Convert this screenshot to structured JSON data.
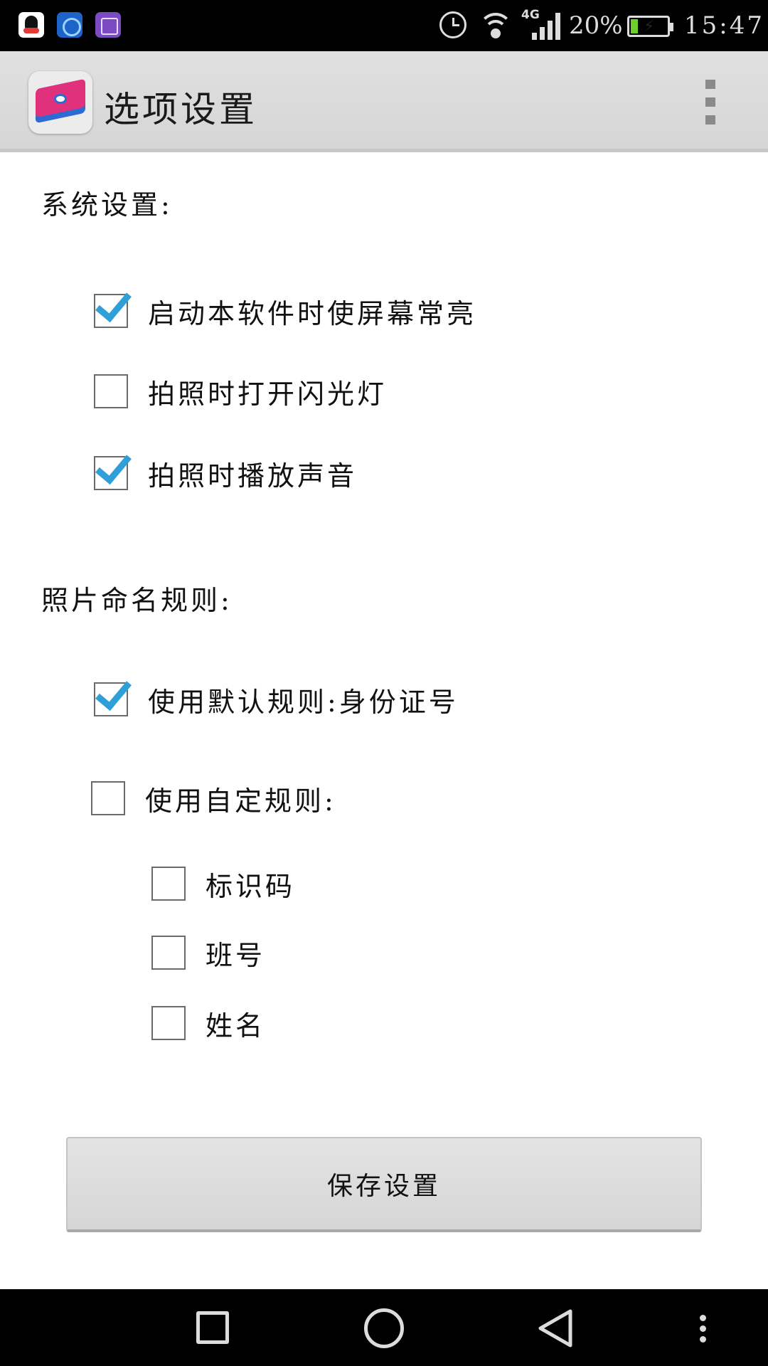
{
  "status_bar": {
    "network_type": "4G",
    "battery_percent": "20%",
    "battery_level": 0.2,
    "battery_bolt_glyph": "⚡",
    "time": "15:47",
    "icons": [
      "qq-icon",
      "browser-icon",
      "gallery-icon",
      "alarm-icon",
      "wifi-icon",
      "signal-icon",
      "battery-charging-icon"
    ]
  },
  "action_bar": {
    "title": "选项设置",
    "logo_icon": "app-logo-icon",
    "menu_icon": "overflow-menu-icon"
  },
  "system_settings": {
    "heading": "系统设置:",
    "options": [
      {
        "label": "启动本软件时使屏幕常亮",
        "checked": true
      },
      {
        "label": "拍照时打开闪光灯",
        "checked": false
      },
      {
        "label": "拍照时播放声音",
        "checked": true
      }
    ]
  },
  "naming_rules": {
    "heading": "照片命名规则:",
    "default_rule": {
      "label": "使用默认规则:身份证号",
      "checked": true
    },
    "custom_rule": {
      "label": "使用自定规则:",
      "checked": false
    },
    "custom_fields": [
      {
        "label": "标识码",
        "checked": false
      },
      {
        "label": "班号",
        "checked": false
      },
      {
        "label": "姓名",
        "checked": false
      }
    ]
  },
  "save_button": {
    "label": "保存设置"
  },
  "nav_bar": {
    "icons": [
      "recent-apps-icon",
      "home-icon",
      "back-icon",
      "more-options-icon"
    ]
  },
  "colors": {
    "check_accent": "#2f9fd8",
    "action_bar_bg": "#dcdcdc",
    "status_bar_bg": "#000000"
  }
}
